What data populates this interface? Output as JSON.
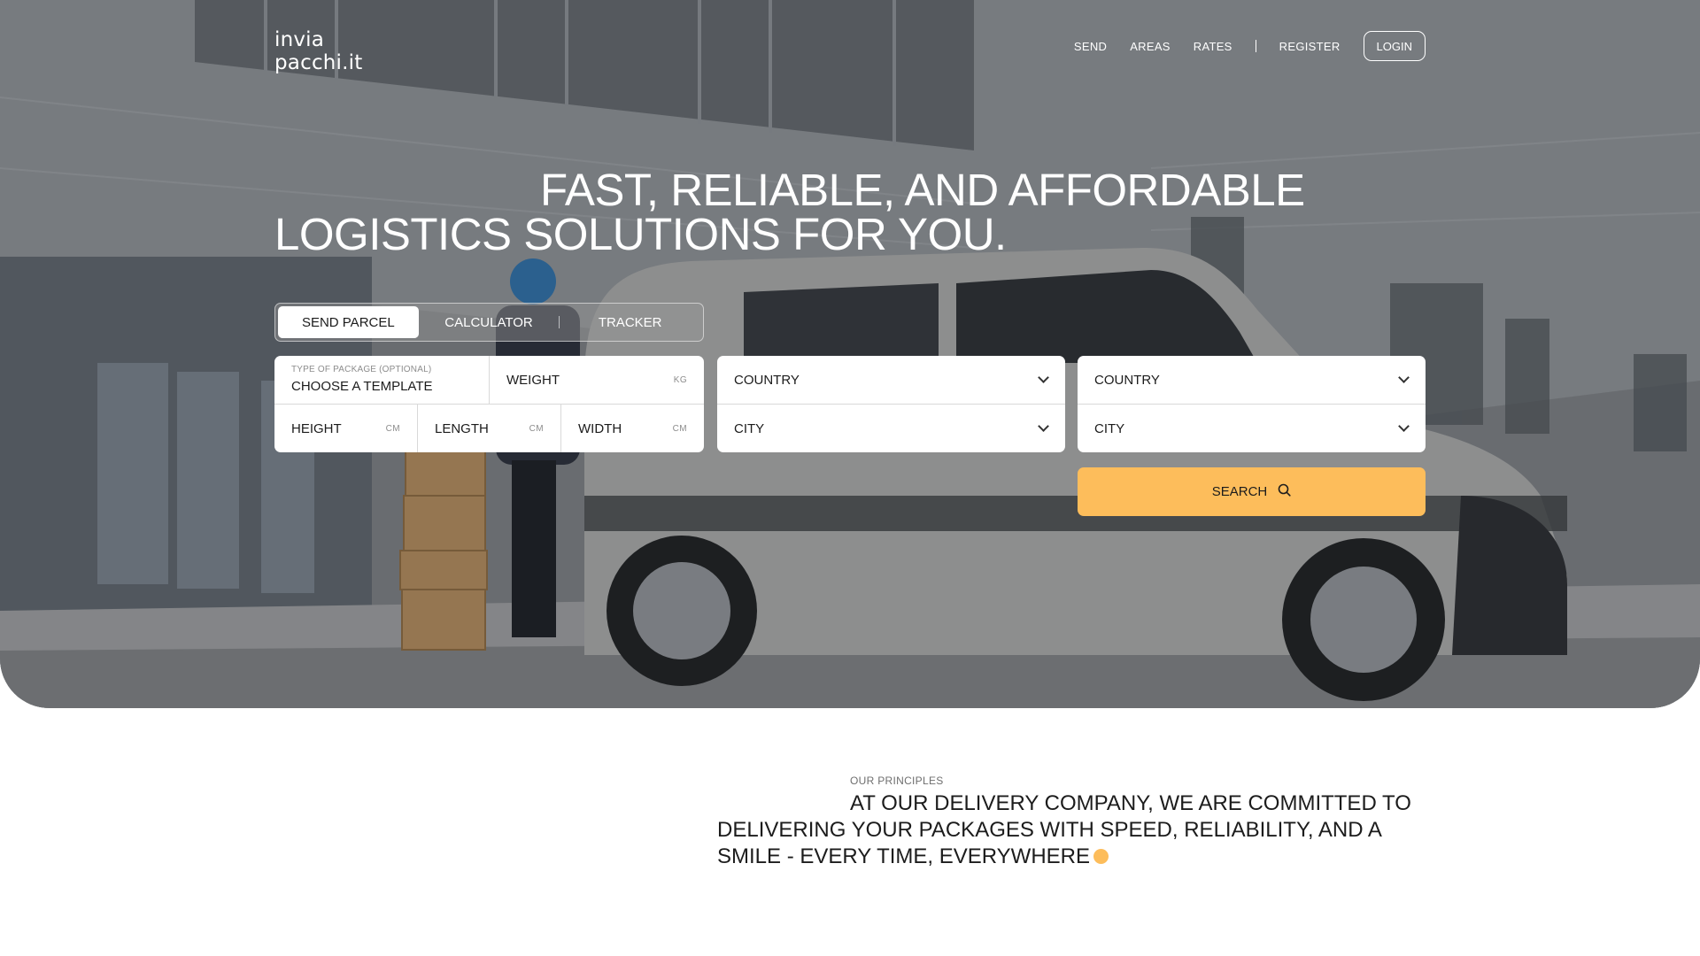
{
  "brand": {
    "line1": "invia",
    "line2": "pacchi.it"
  },
  "nav": {
    "links": [
      "SEND",
      "AREAS",
      "RATES"
    ],
    "register": "REGISTER",
    "login": "LOGIN"
  },
  "hero": {
    "headline_line1": "FAST, RELIABLE, AND AFFORDABLE",
    "headline_line2": "LOGISTICS SOLUTIONS FOR YOU."
  },
  "tabs": [
    {
      "label": "SEND PARCEL",
      "active": true
    },
    {
      "label": "CALCULATOR",
      "active": false
    },
    {
      "label": "TRACKER",
      "active": false
    }
  ],
  "package_form": {
    "template_label": "TYPE OF PACKAGE (OPTIONAL)",
    "template_value": "CHOOSE A TEMPLATE",
    "weight": {
      "label": "WEIGHT",
      "unit": "KG"
    },
    "height": {
      "label": "HEIGHT",
      "unit": "CM"
    },
    "length": {
      "label": "LENGTH",
      "unit": "CM"
    },
    "width": {
      "label": "WIDTH",
      "unit": "CM"
    }
  },
  "origin": {
    "country": "COUNTRY",
    "city": "CITY"
  },
  "destination": {
    "country": "COUNTRY",
    "city": "CITY"
  },
  "search_label": "SEARCH",
  "principles": {
    "label": "OUR PRINCIPLES",
    "text_line1": "AT OUR DELIVERY COMPANY, WE ARE COMMITTED TO",
    "text_line2": "DELIVERING YOUR PACKAGES WITH SPEED, RELIABILITY, AND A",
    "text_line3": "SMILE - EVERY TIME, EVERYWHERE"
  },
  "colors": {
    "accent": "#fdbd5b",
    "text": "#1c1c1c",
    "white": "#ffffff"
  }
}
